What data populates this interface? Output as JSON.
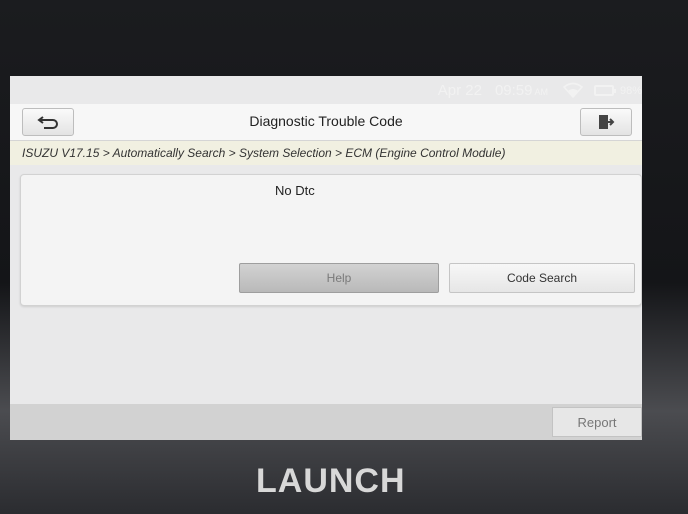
{
  "status": {
    "date": "Apr 22",
    "time": "09:59",
    "ampm": "AM",
    "battery": "98%"
  },
  "header": {
    "title": "Diagnostic Trouble Code"
  },
  "breadcrumb": "ISUZU V17.15 > Automatically Search > System Selection > ECM (Engine Control Module)",
  "main": {
    "message": "No Dtc",
    "help_label": "Help",
    "code_search_label": "Code Search"
  },
  "footer": {
    "report_label": "Report"
  },
  "device": {
    "brand": "LAUNCH"
  }
}
